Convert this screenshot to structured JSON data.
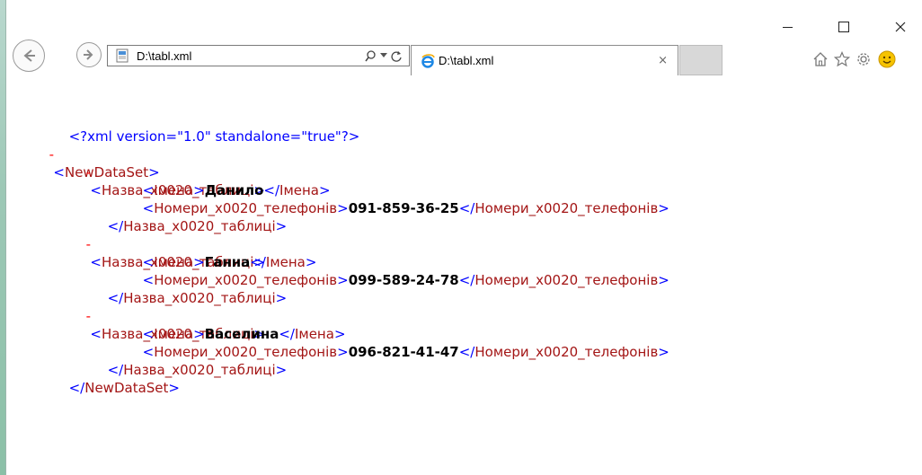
{
  "window": {
    "controls": {
      "minimize": "minimize",
      "maximize": "maximize",
      "close": "close"
    }
  },
  "toolbar": {
    "address": "D:\\tabl.xml",
    "tab_title": "D:\\tabl.xml",
    "tab_close_glyph": "×",
    "refresh_glyph": "C",
    "icons": [
      "back-icon",
      "forward-icon",
      "search-icon",
      "dropdown-icon",
      "refresh-icon",
      "home-icon",
      "star-icon",
      "gear-icon",
      "smiley-icon"
    ]
  },
  "xml": {
    "declaration": "<?xml version=\"1.0\" standalone=\"true\"?>",
    "collapse_glyph": "-",
    "root_tag": "NewDataSet",
    "record_tag": "Назва_x0020_таблиці",
    "name_tag": "Імена",
    "phone_tag": "Номери_x0020_телефонів",
    "records": [
      {
        "name": "Данило",
        "phone": "091-859-36-25"
      },
      {
        "name": "Ганна",
        "phone": "099-589-24-78"
      },
      {
        "name": "Васелина",
        "phone": "096-821-41-47"
      }
    ]
  },
  "colors": {
    "pi": "#0000ff",
    "tag": "#a31515",
    "bracket": "#0000ff",
    "minus": "#ff0000",
    "value": "#000000"
  }
}
